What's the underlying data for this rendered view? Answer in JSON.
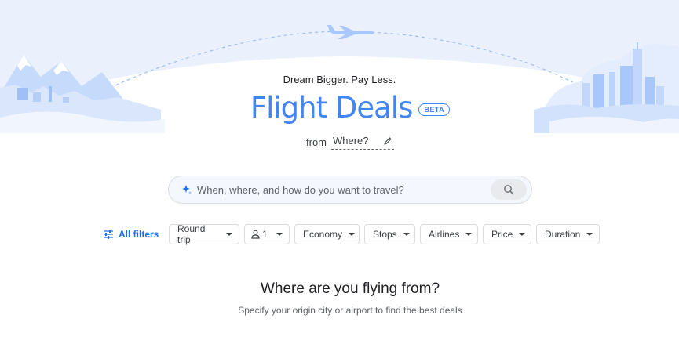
{
  "hero": {
    "tagline": "Dream Bigger. Pay Less.",
    "title": "Flight Deals",
    "badge": "BETA"
  },
  "origin": {
    "prefix": "from",
    "value": "Where?",
    "edit_icon": "pencil-icon"
  },
  "search": {
    "icon": "sparkle-icon",
    "placeholder": "When, where, and how do you want to travel?",
    "button_icon": "search-icon"
  },
  "filters": {
    "all_label": "All filters",
    "trip_type": "Round trip",
    "passengers": "1",
    "cabin": "Economy",
    "stops": "Stops",
    "airlines": "Airlines",
    "price": "Price",
    "duration": "Duration"
  },
  "empty_state": {
    "title": "Where are you flying from?",
    "subtitle": "Specify your origin city or airport to find the best deals"
  },
  "colors": {
    "accent": "#4285f4",
    "link": "#1a73e8",
    "illustration_light": "#e8f0fe",
    "illustration_mid": "#aecbfa"
  }
}
